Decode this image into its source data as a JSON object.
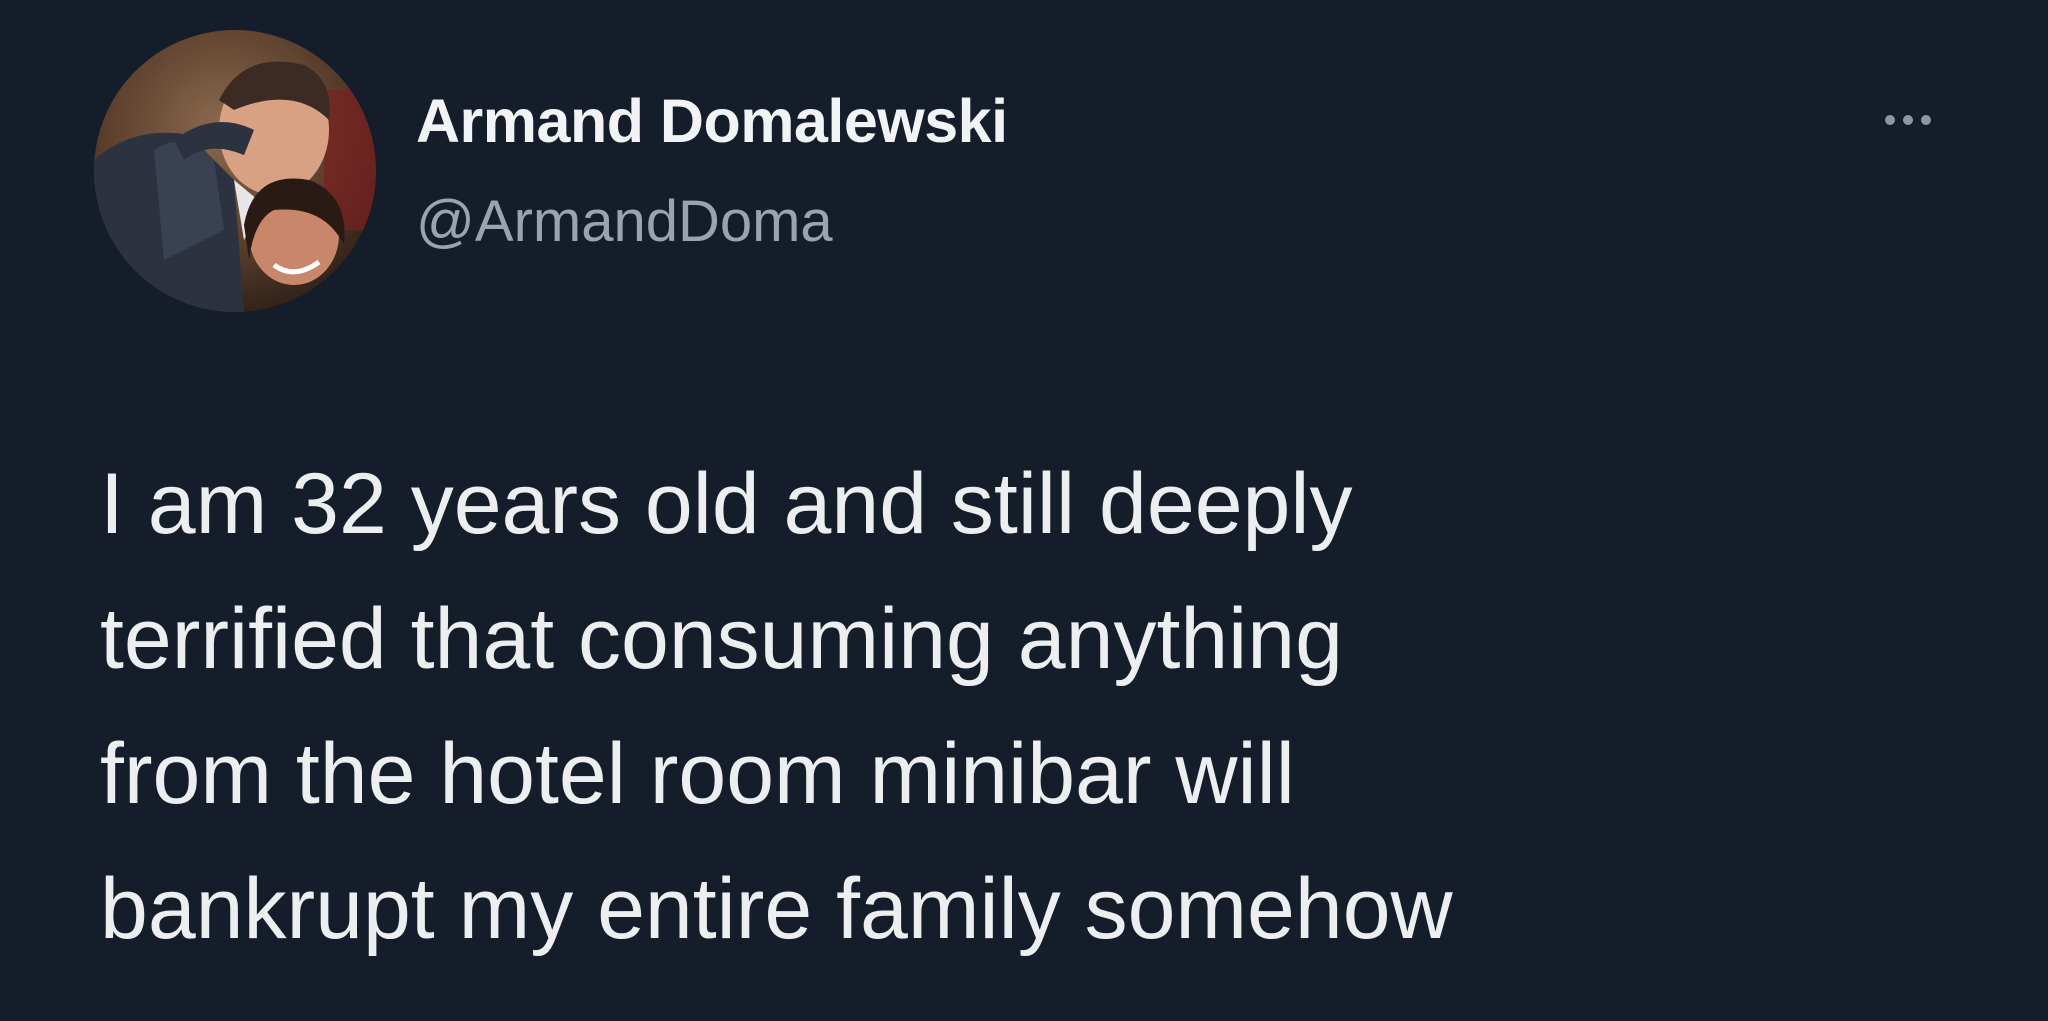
{
  "tweet": {
    "author": {
      "display_name": "Armand Domalewski",
      "handle": "@ArmandDoma",
      "avatar_icon": "profile-photo"
    },
    "more_icon": "more-options-icon",
    "text_lines": [
      "I am 32 years old and still deeply",
      "terrified that consuming anything",
      "from the hotel room minibar will",
      "bankrupt my entire family somehow"
    ]
  },
  "colors": {
    "background": "#151d2b",
    "name": "#f1f3f5",
    "handle": "#9aa4ae",
    "text": "#eceef0"
  }
}
